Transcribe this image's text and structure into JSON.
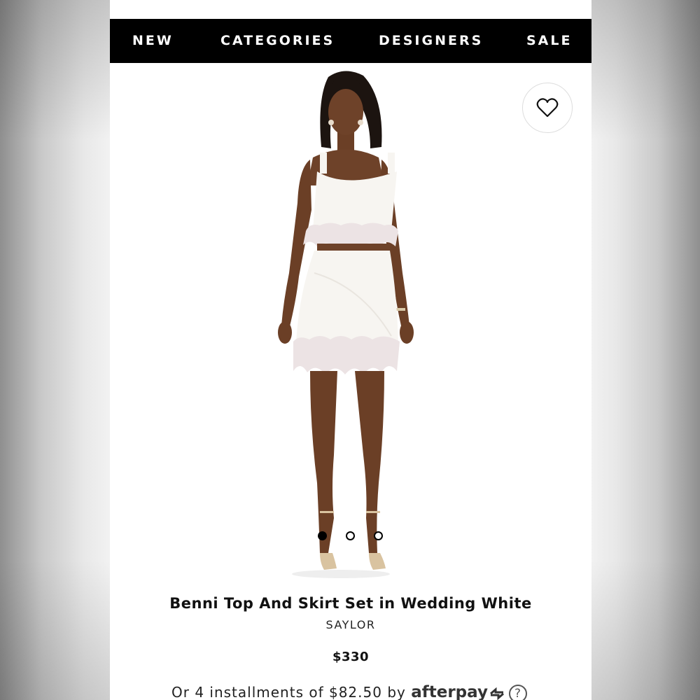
{
  "nav": {
    "items": [
      {
        "label": "NEW"
      },
      {
        "label": "CATEGORIES"
      },
      {
        "label": "DESIGNERS"
      },
      {
        "label": "SALE"
      }
    ]
  },
  "carousel": {
    "image_count": 3,
    "active_index": 0
  },
  "product": {
    "title": "Benni Top And Skirt Set in Wedding White",
    "brand": "SAYLOR",
    "price": "$330"
  },
  "afterpay": {
    "text": "Or 4 installments of $82.50 by",
    "logo_text": "afterpay",
    "help_icon": "?"
  },
  "icons": {
    "wishlist": "heart-outline-icon",
    "afterpay": "afterpay-arrows-icon",
    "help": "question-circle-icon"
  },
  "colors": {
    "nav_background": "#000000",
    "nav_text": "#ffffff",
    "page_background": "#ffffff"
  }
}
